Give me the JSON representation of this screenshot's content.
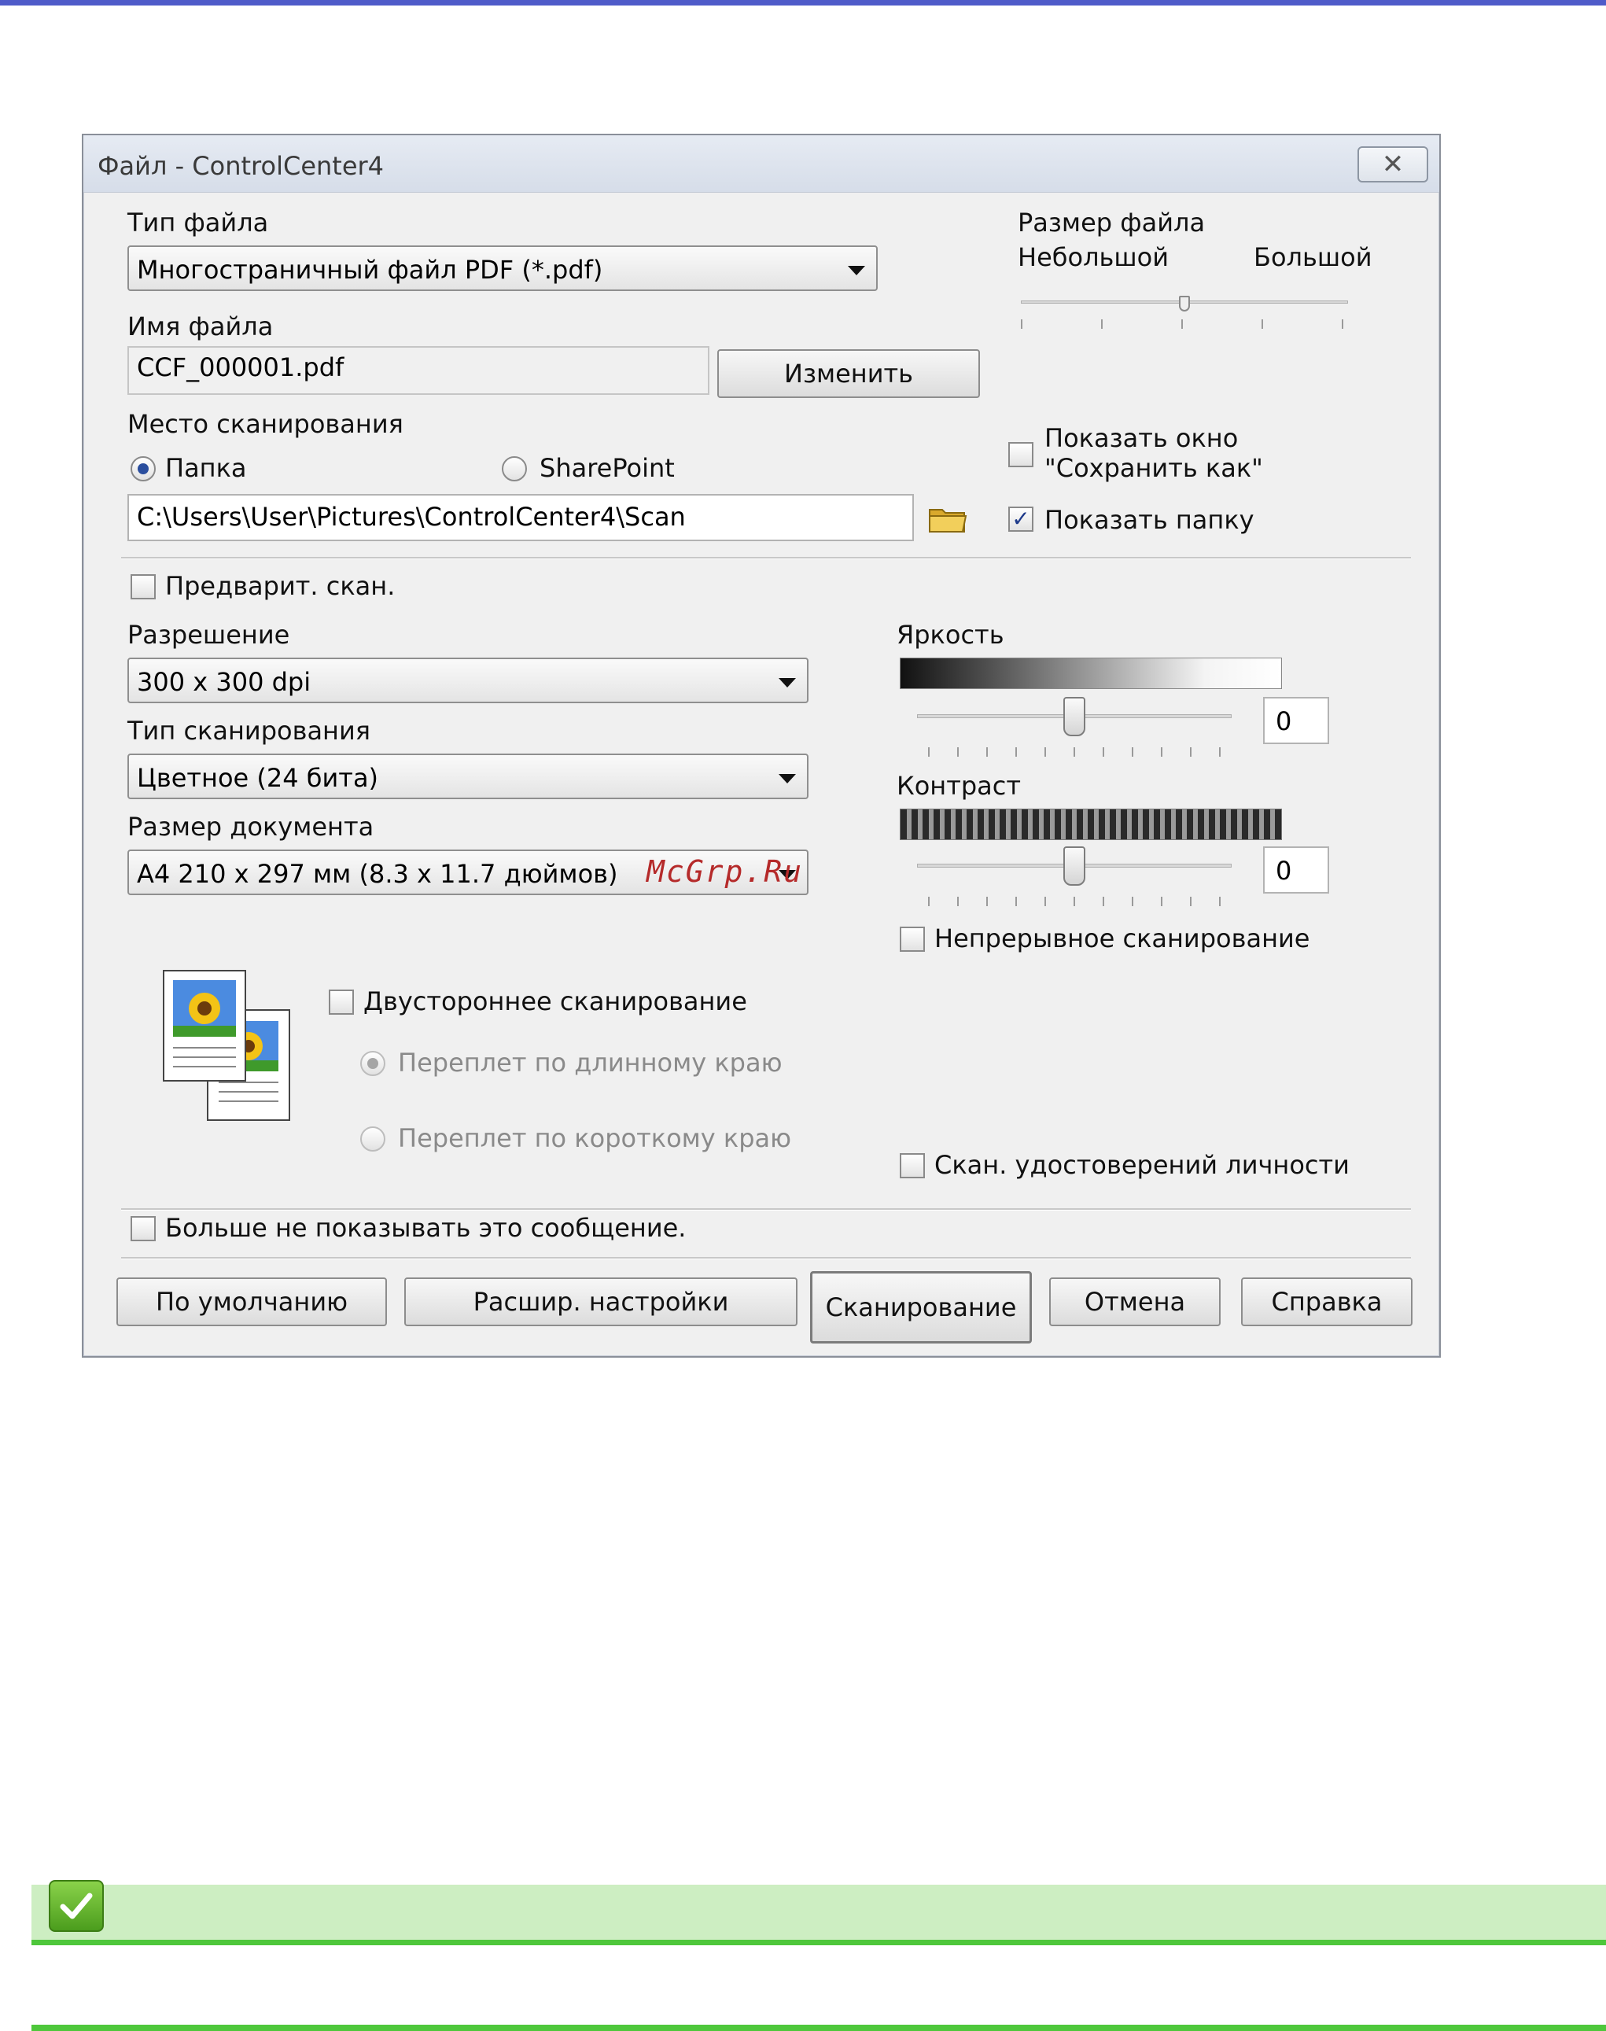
{
  "dialog": {
    "title": "Файл - ControlCenter4",
    "close_glyph": "✕",
    "file_type": {
      "label": "Тип файла",
      "value": "Многостраничный файл PDF (*.pdf)"
    },
    "file_size": {
      "label": "Размер файла",
      "min_label": "Небольшой",
      "max_label": "Большой",
      "level": 0.5
    },
    "file_name": {
      "label": "Имя файла",
      "value": "CCF_000001.pdf",
      "change_button": "Изменить"
    },
    "scan_location": {
      "label": "Место сканирования",
      "option_folder": "Папка",
      "option_sharepoint": "SharePoint",
      "selected": "Папка",
      "path": "C:\\Users\\User\\Pictures\\ControlCenter4\\Scan"
    },
    "show_save_as": {
      "label": "Показать окно \"Сохранить как\"",
      "checked": false
    },
    "show_folder": {
      "label": "Показать папку",
      "checked": true
    },
    "prescan": {
      "label": "Предварит. скан.",
      "checked": false
    },
    "resolution": {
      "label": "Разрешение",
      "value": "300 x 300  dpi"
    },
    "scan_type": {
      "label": "Тип сканирования",
      "value": "Цветное (24 бита)"
    },
    "document_size": {
      "label": "Размер документа",
      "value": "A4 210 x 297 мм (8.3 x 11.7 дюймов)"
    },
    "brightness": {
      "label": "Яркость",
      "value": "0"
    },
    "contrast": {
      "label": "Контраст",
      "value": "0"
    },
    "continuous_scan": {
      "label": "Непрерывное сканирование",
      "checked": false
    },
    "duplex": {
      "label": "Двустороннее сканирование",
      "checked": false,
      "long_edge": "Переплет по длинному краю",
      "short_edge": "Переплет по короткому краю"
    },
    "id_card_scan": {
      "label": "Скан. удостоверений личности",
      "checked": false
    },
    "dont_show_again": {
      "label": "Больше не показывать это сообщение.",
      "checked": false
    },
    "buttons": {
      "default": "По умолчанию",
      "advanced": "Расшир. настройки",
      "scan": "Сканирование",
      "cancel": "Отмена",
      "help": "Справка"
    }
  },
  "watermark": "McGrp.Ru",
  "colors": {
    "top_bar": "#4f5bc9",
    "note_bar": "#cdeec2",
    "note_line": "#4ec73b",
    "watermark": "#b52a2a"
  }
}
